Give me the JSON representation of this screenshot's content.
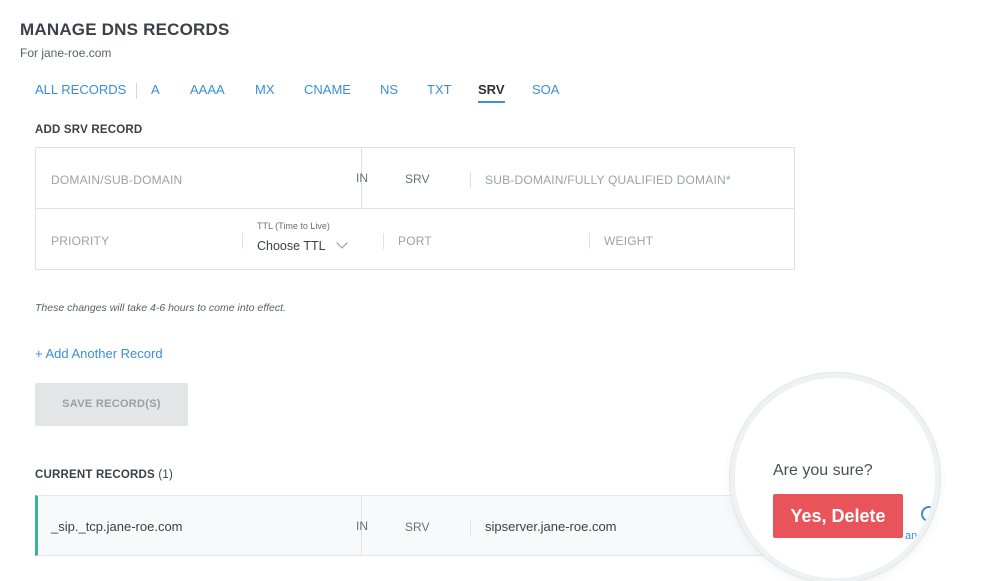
{
  "header": {
    "title": "MANAGE DNS RECORDS",
    "subtitle": "For jane-roe.com"
  },
  "tabs": [
    {
      "label": "ALL RECORDS",
      "active": false
    },
    {
      "label": "A",
      "active": false
    },
    {
      "label": "AAAA",
      "active": false
    },
    {
      "label": "MX",
      "active": false
    },
    {
      "label": "CNAME",
      "active": false
    },
    {
      "label": "NS",
      "active": false
    },
    {
      "label": "TXT",
      "active": false
    },
    {
      "label": "SRV",
      "active": true
    },
    {
      "label": "SOA",
      "active": false
    }
  ],
  "add_section": {
    "title": "ADD SRV RECORD",
    "domain_placeholder": "DOMAIN/SUB-DOMAIN",
    "class": "IN",
    "type": "SRV",
    "target_placeholder": "SUB-DOMAIN/FULLY QUALIFIED DOMAIN*",
    "priority_placeholder": "PRIORITY",
    "ttl_caption": "TTL (Time to Live)",
    "ttl_value": "Choose TTL",
    "port_placeholder": "PORT",
    "weight_placeholder": "WEIGHT"
  },
  "note": "These changes will take 4-6 hours to come into effect.",
  "add_link": "+ Add Another Record",
  "save_button": "SAVE RECORD(S)",
  "current": {
    "title": "CURRENT RECORDS",
    "count": "(1)",
    "records": [
      {
        "name": "_sip._tcp.jane-roe.com",
        "class": "IN",
        "type": "SRV",
        "target": "sipserver.jane-roe.com"
      }
    ]
  },
  "confirm": {
    "question": "Are you sure?",
    "yes_label": "Yes, Delete",
    "cancel_label": "ancel"
  },
  "colors": {
    "accent": "#3a8fd6",
    "danger": "#e8545a",
    "record_marker": "#35b59a",
    "disabled_button": "#e3e5e7"
  }
}
